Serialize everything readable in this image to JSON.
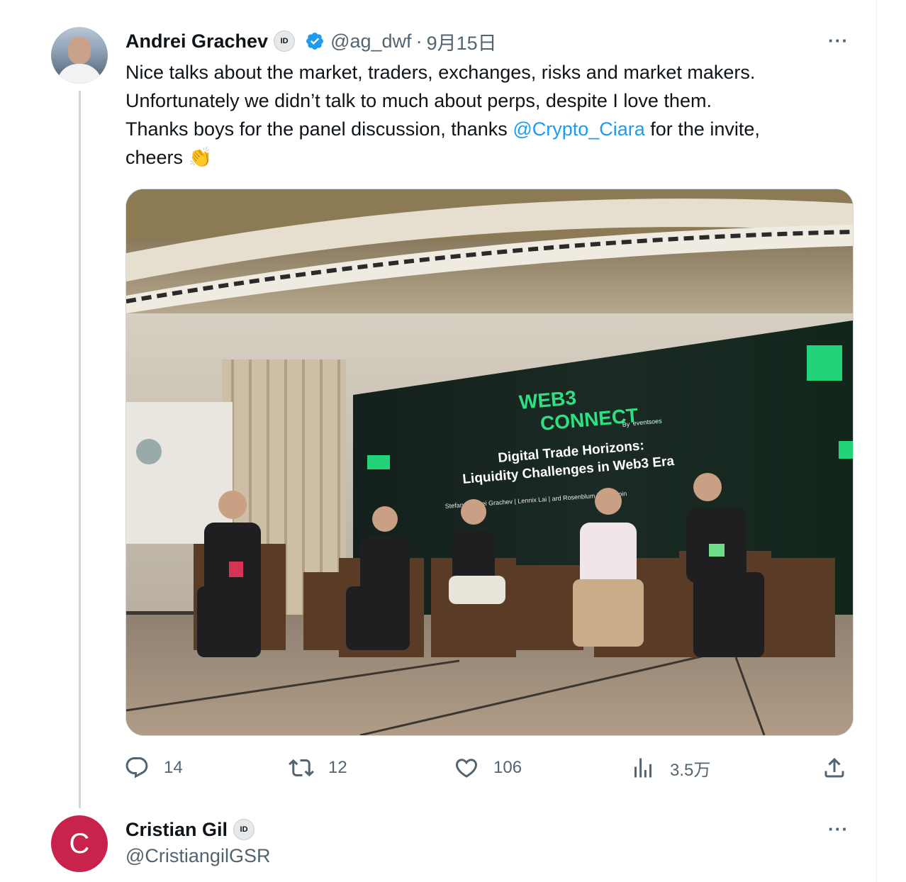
{
  "tweet": {
    "author_name": "Andrei Grachev",
    "id_badge": "ID",
    "handle": "@ag_dwf",
    "separator": "·",
    "date": "9月15日",
    "text_lines": [
      "Nice talks about the market, traders, exchanges, risks and market makers.",
      "Unfortunately we didn’t talk to much about perps, despite I love them."
    ],
    "line3_before": "Thanks boys for the panel discussion, thanks ",
    "mention": "@Crypto_Ciara",
    "line3_after": " for the invite,",
    "line4_text": "cheers ",
    "emoji": "👏",
    "more_icon": "···",
    "photo": {
      "screen_logo_line1": "WEB3",
      "screen_logo_line2": "CONNECT",
      "screen_logo_by": "By",
      "screen_logo_brand": "eventsoes",
      "screen_title_line1": "Digital Trade Horizons:",
      "screen_title_line2": "Liquidity Challenges in Web3 Era",
      "screen_names": "Stefan  |  Andrei Grachev  |  Lennix Lai  |  ard Rosenblum  |  an Turpin"
    },
    "actions": {
      "reply_count": "14",
      "retweet_count": "12",
      "like_count": "106",
      "views_count": "3.5万"
    },
    "icons": {
      "reply": "reply-icon",
      "retweet": "retweet-icon",
      "like": "heart-icon",
      "views": "views-icon",
      "share": "share-icon",
      "verified": "verified-badge-icon"
    },
    "colors": {
      "link": "#1d9bf0",
      "secondary_text": "#536471",
      "verified": "#1d9bf0"
    }
  },
  "reply": {
    "avatar_letter": "C",
    "author_name": "Cristian Gil",
    "id_badge": "ID",
    "handle": "@CristiangilGSR",
    "more_icon": "···",
    "avatar_color": "#c8234d"
  }
}
